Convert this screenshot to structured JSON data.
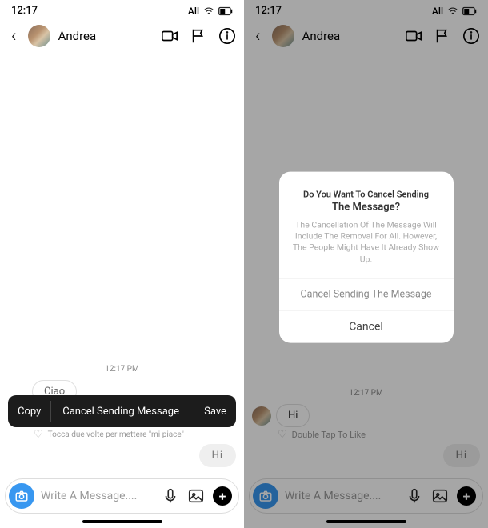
{
  "status": {
    "time": "12:17",
    "carrier": "All"
  },
  "contact": {
    "name": "Andrea"
  },
  "left": {
    "timestamp": "12:17 PM",
    "recv_partial": "Ciao",
    "like_hint": "Tocca due volte per mettere \"mi piace\"",
    "sent": "Hi",
    "context": {
      "copy": "Copy",
      "cancel_send": "Cancel Sending Message",
      "save": "Save"
    }
  },
  "right": {
    "timestamp": "12:17 PM",
    "recv": "Hi",
    "like_hint": "Double Tap To Like",
    "sent": "Hi"
  },
  "dialog": {
    "line1": "Do You Want To Cancel Sending",
    "line2": "The Message?",
    "body": "The Cancellation Of The Message Will Include The Removal For All. However, The People Might Have It Already Show Up.",
    "primary": "Cancel Sending The Message",
    "secondary": "Cancel"
  },
  "input": {
    "placeholder": "Write A Message...."
  }
}
